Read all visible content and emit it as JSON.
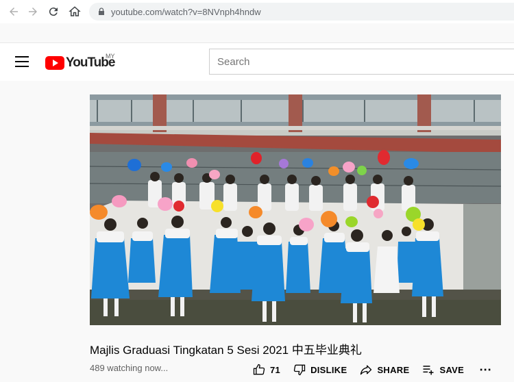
{
  "browser": {
    "url": "youtube.com/watch?v=8NVnph4hndw"
  },
  "header": {
    "logo_text": "YouTube",
    "region": "MY",
    "search_placeholder": "Search"
  },
  "video": {
    "title": "Majlis Graduasi Tingkatan 5 Sesi 2021 中五毕业典礼",
    "watching": "489 watching now...",
    "likes": "71",
    "dislike_label": "DISLIKE",
    "share_label": "SHARE",
    "save_label": "SAVE"
  },
  "colors": {
    "accent_red": "#ff0000",
    "uniform_blue": "#1e88d6",
    "wall_white": "#e8e8e4"
  }
}
